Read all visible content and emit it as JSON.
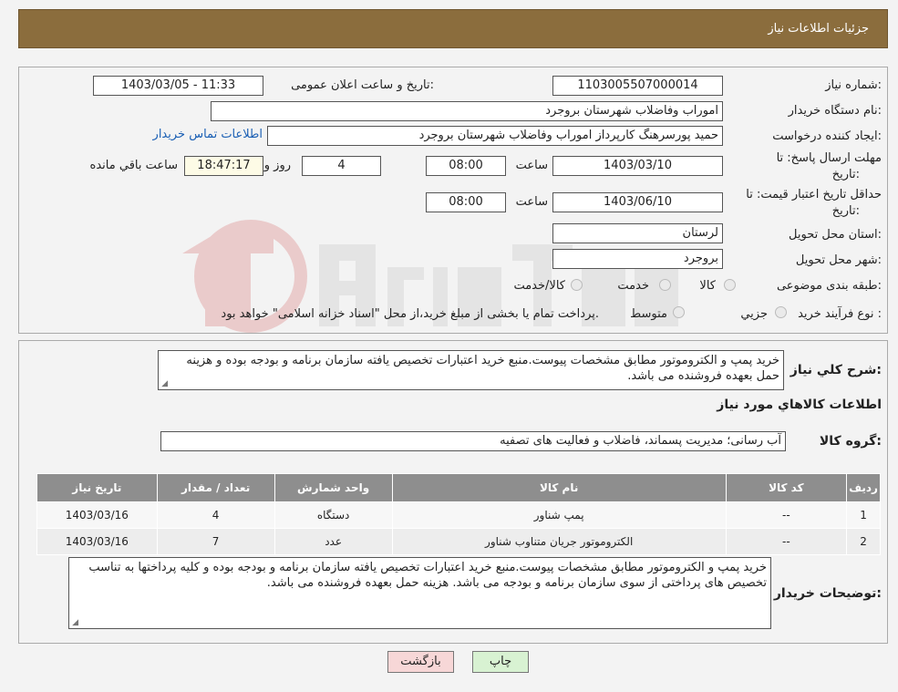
{
  "header": {
    "title": "جزئیات اطلاعات نیاز"
  },
  "form": {
    "need_number_label": "شماره نیاز:",
    "need_number": "1103005507000014",
    "announce_label": "تاریخ و ساعت اعلان عمومی:",
    "announce_value": "1403/03/05 - 11:33",
    "buyer_org_label": "نام دستگاه خریدار:",
    "buyer_org": "اموراب وفاضلاب شهرستان بروجرد",
    "creator_label": "ایجاد کننده درخواست:",
    "creator": "حمید پورسرهنگ کارپرداز اموراب وفاضلاب شهرستان بروجرد",
    "contact_link": "اطلاعات تماس خریدار",
    "deadline_label_1": "مهلت ارسال پاسخ: تا",
    "deadline_label_2": "تاریخ:",
    "deadline_date": "1403/03/10",
    "time_label": "ساعت",
    "deadline_time": "08:00",
    "days_value": "4",
    "days_label": "روز و",
    "remaining_time": "18:47:17",
    "remaining_label": "ساعت باقي مانده",
    "validity_label_1": "حداقل تاریخ اعتبار قیمت: تا",
    "validity_label_2": "تاریخ:",
    "validity_date": "1403/06/10",
    "validity_time": "08:00",
    "province_label": "استان محل تحویل:",
    "province": "لرستان",
    "city_label": "شهر محل تحویل:",
    "city": "بروجرد",
    "category_label": "طبقه بندی موضوعی:",
    "category_options": [
      "کالا",
      "خدمت",
      "کالا/خدمت"
    ],
    "process_label": "نوع فرآیند خرید :",
    "process_options": [
      "جزیي",
      "متوسط"
    ],
    "process_note": "پرداخت تمام یا بخشی از مبلغ خرید،از محل \"اسناد خزانه اسلامی\" خواهد بود."
  },
  "desc": {
    "label": "شرح کلي نياز:",
    "text": "خرید پمپ و الکتروموتور مطابق مشخصات پیوست.منبع خرید اعتبارات تخصیص یافته سازمان برنامه و بودجه بوده و هزینه حمل بعهده فروشنده می باشد.",
    "items_title": "اطلاعات کالاهاي مورد نياز",
    "group_label": "گروه کالا:",
    "group_value": "آب رسانی؛ مدیریت پسماند، فاضلاب و فعالیت های تصفیه"
  },
  "table": {
    "headers": [
      "رديف",
      "کد کالا",
      "نام کالا",
      "واحد شمارش",
      "تعداد / مقدار",
      "تاریخ نیاز"
    ],
    "rows": [
      [
        "1",
        "--",
        "پمپ شناور",
        "دستگاه",
        "4",
        "1403/03/16"
      ],
      [
        "2",
        "--",
        "الکتروموتور جریان متناوب شناور",
        "عدد",
        "7",
        "1403/03/16"
      ]
    ]
  },
  "buyer_notes": {
    "label": "توضيحات خريدار:",
    "text": "خرید پمپ و الکتروموتور مطابق مشخصات پیوست.منبع خرید اعتبارات تخصیص یافته سازمان برنامه و بودجه بوده و کلیه پرداختها به تناسب تخصیص های پرداختی از سوی سازمان برنامه و بودجه می باشد. هزینه حمل بعهده فروشنده می باشد."
  },
  "buttons": {
    "print": "چاپ",
    "back": "بازگشت"
  },
  "colors": {
    "header_bg": "#8b6d3d",
    "table_header": "#8e8e8e",
    "back_btn": "#f7d7d7",
    "print_btn": "#d8f2d2",
    "link": "#1a5fb4"
  }
}
